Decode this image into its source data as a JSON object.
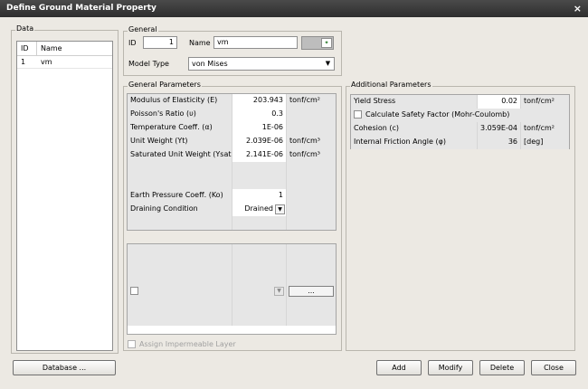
{
  "window": {
    "title": "Define Ground Material Property",
    "close_glyph": "×"
  },
  "data_panel": {
    "title": "Data",
    "columns": [
      "ID",
      "Name"
    ],
    "rows": [
      {
        "id": "1",
        "name": "vm"
      }
    ]
  },
  "general": {
    "title": "General",
    "id_label": "ID",
    "id_value": "1",
    "name_label": "Name",
    "name_value": "vm",
    "model_type_label": "Model Type",
    "model_type_value": "von Mises"
  },
  "general_params": {
    "title": "General Parameters",
    "rows": [
      {
        "label": "Modulus of Elasticity (E)",
        "value": "203.943",
        "unit": "tonf/cm²"
      },
      {
        "label": "Poisson's Ratio (υ)",
        "value": "0.3",
        "unit": ""
      },
      {
        "label": "Temperature Coeff. (α)",
        "value": "1E-06",
        "unit": ""
      },
      {
        "label": "Unit Weight (Yt)",
        "value": "2.039E-06",
        "unit": "tonf/cm³"
      },
      {
        "label": "Saturated Unit Weight (Ysat)",
        "value": "2.141E-06",
        "unit": "tonf/cm³"
      }
    ],
    "ko_label": "Earth Pressure Coeff. (Ko)",
    "ko_value": "1",
    "drain_label": "Draining Condition",
    "drain_value": "Drained",
    "dots_label": "...",
    "impermeable_label": "Assign Impermeable Layer"
  },
  "additional_params": {
    "title": "Additional Parameters",
    "yield_label": "Yield Stress",
    "yield_value": "0.02",
    "yield_unit": "tonf/cm²",
    "safety_label": "Calculate Safety Factor (Mohr-Coulomb)",
    "cohesion_label": "Cohesion (c)",
    "cohesion_value": "3.059E-04",
    "cohesion_unit": "tonf/cm²",
    "friction_label": "Internal Friction Angle (φ)",
    "friction_value": "36",
    "friction_unit": "[deg]"
  },
  "buttons": {
    "database": "Database ...",
    "add": "Add",
    "modify": "Modify",
    "delete": "Delete",
    "close": "Close"
  }
}
